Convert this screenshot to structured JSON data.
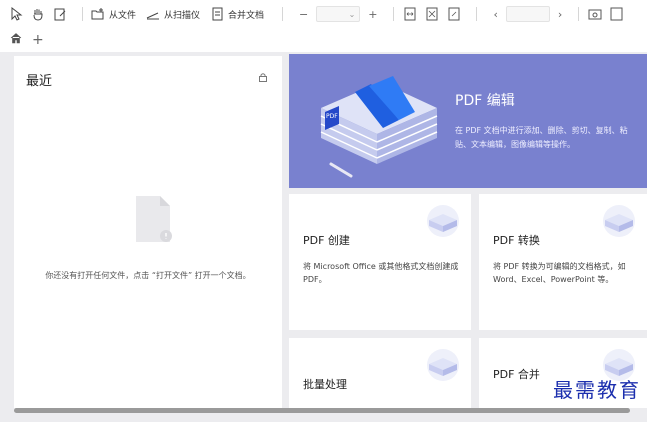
{
  "toolbar": {
    "open_file_label": "从文件",
    "scanner_label": "从扫描仪",
    "merge_label": "合并文档",
    "zoom_minus": "−",
    "zoom_plus": "+",
    "zoom_dropdown": "⌄",
    "page_prev": "‹",
    "page_next": "›"
  },
  "tabs": {
    "add_label": "+"
  },
  "recent": {
    "title": "最近",
    "empty_text": "你还没有打开任何文件，点击 “打开文件” 打开一个文档。"
  },
  "hero": {
    "title": "PDF 编辑",
    "description": "在 PDF 文档中进行添加、删除、剪切、复制、粘贴、文本编辑，图像编辑等操作。"
  },
  "cards": [
    {
      "title": "PDF 创建",
      "description": "将 Microsoft Office 或其他格式文档创建成 PDF。"
    },
    {
      "title": "PDF 转换",
      "description": "将 PDF 转换为可编辑的文档格式，如 Word、Excel、PowerPoint 等。"
    },
    {
      "title": "批量处理",
      "description": ""
    },
    {
      "title": "PDF 合并",
      "description": ""
    }
  ],
  "watermark": "最需教育",
  "colors": {
    "hero_bg": "#7981cf",
    "panel_bg": "#ececef",
    "watermark": "#1c2fae"
  }
}
